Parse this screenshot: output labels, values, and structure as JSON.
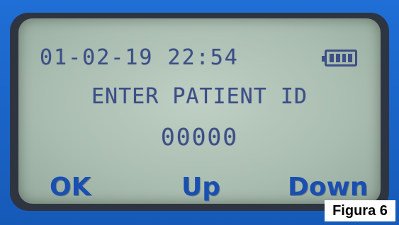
{
  "screen": {
    "datetime": "01-02-19 22:54",
    "prompt": "ENTER PATIENT ID",
    "patient_id": "00000",
    "battery_level": 1.0
  },
  "softkeys": {
    "ok": "OK",
    "up": "Up",
    "down": "Down"
  },
  "caption": "Figura 6",
  "colors": {
    "device_body": "#1a63c6",
    "lcd_background": "#aabfb1",
    "lcd_text": "#3d4f86",
    "softkey_text": "#1a4fb0"
  },
  "icons": [
    "battery-icon"
  ]
}
